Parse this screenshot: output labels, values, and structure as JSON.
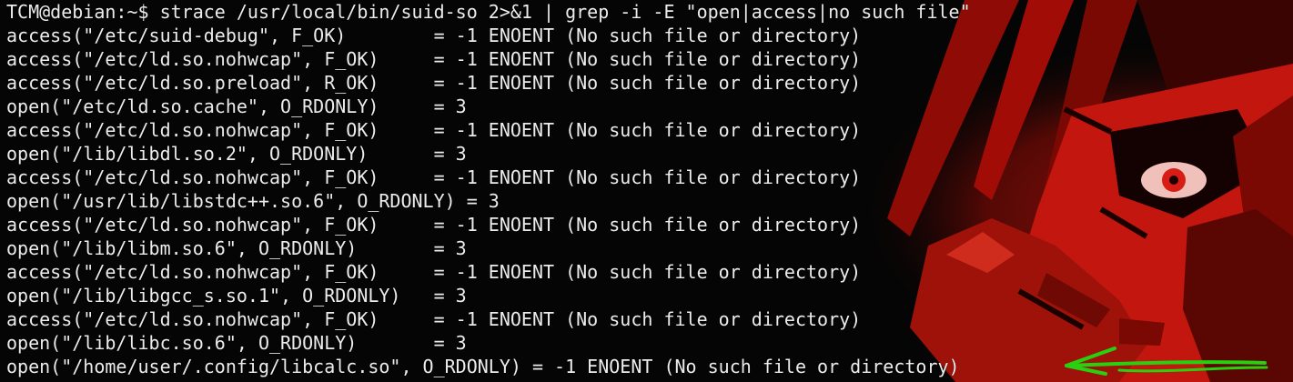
{
  "terminal": {
    "prompt": "TCM@debian:~$ ",
    "command": "strace /usr/local/bin/suid-so 2>&1 | grep -i -E \"open|access|no such file\"",
    "lines": [
      "access(\"/etc/suid-debug\", F_OK)        = -1 ENOENT (No such file or directory)",
      "access(\"/etc/ld.so.nohwcap\", F_OK)     = -1 ENOENT (No such file or directory)",
      "access(\"/etc/ld.so.preload\", R_OK)     = -1 ENOENT (No such file or directory)",
      "open(\"/etc/ld.so.cache\", O_RDONLY)     = 3",
      "access(\"/etc/ld.so.nohwcap\", F_OK)     = -1 ENOENT (No such file or directory)",
      "open(\"/lib/libdl.so.2\", O_RDONLY)      = 3",
      "access(\"/etc/ld.so.nohwcap\", F_OK)     = -1 ENOENT (No such file or directory)",
      "open(\"/usr/lib/libstdc++.so.6\", O_RDONLY) = 3",
      "access(\"/etc/ld.so.nohwcap\", F_OK)     = -1 ENOENT (No such file or directory)",
      "open(\"/lib/libm.so.6\", O_RDONLY)       = 3",
      "access(\"/etc/ld.so.nohwcap\", F_OK)     = -1 ENOENT (No such file or directory)",
      "open(\"/lib/libgcc_s.so.1\", O_RDONLY)   = 3",
      "access(\"/etc/ld.so.nohwcap\", F_OK)     = -1 ENOENT (No such file or directory)",
      "open(\"/lib/libc.so.6\", O_RDONLY)       = 3",
      "open(\"/home/user/.config/libcalc.so\", O_RDONLY) = -1 ENOENT (No such file or directory)"
    ]
  },
  "colors": {
    "text": "#ececec",
    "background": "#050505",
    "wallpaper_red": "#c2160f",
    "annotation_arrow": "#27d10f"
  },
  "icons": {
    "annotation": "green-arrow-icon",
    "wallpaper": "red-anime-character-illustration"
  }
}
